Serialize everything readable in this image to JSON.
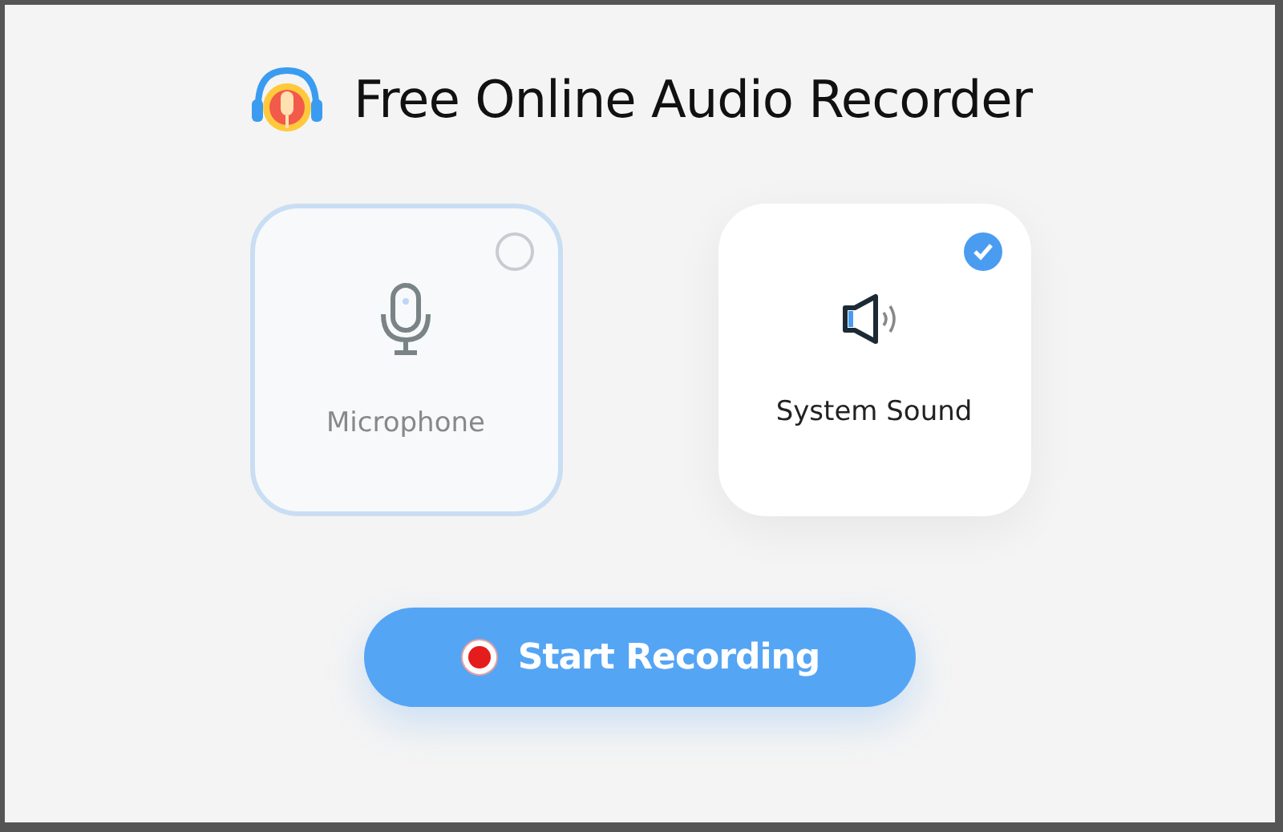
{
  "header": {
    "title": "Free Online Audio Recorder"
  },
  "sources": [
    {
      "kind": "microphone",
      "label": "Microphone",
      "selected": false
    },
    {
      "kind": "speaker",
      "label": "System Sound",
      "selected": true
    }
  ],
  "record_button": {
    "label": "Start Recording"
  }
}
